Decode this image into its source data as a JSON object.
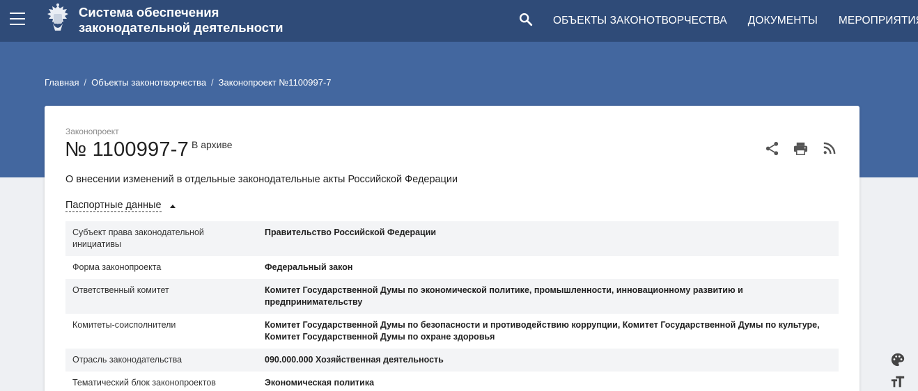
{
  "header": {
    "title_line1": "Система обеспечения",
    "title_line2": "законодательной деятельности",
    "nav": [
      {
        "label": "ОБЪЕКТЫ ЗАКОНОТВОРЧЕСТВА"
      },
      {
        "label": "ДОКУМЕНТЫ"
      },
      {
        "label": "МЕРОПРИЯТИЯ"
      }
    ],
    "icons": {
      "menu": "hamburger-icon",
      "search": "search-icon",
      "logo": "coat-of-arms-emblem"
    }
  },
  "breadcrumb": [
    "Главная",
    "Объекты законотворчества",
    "Законопроект №1100997-7"
  ],
  "bill": {
    "type_label": "Законопроект",
    "number": "№ 1100997-7",
    "status": "В архиве",
    "title": "О внесении изменений в отдельные законодательные акты Российской Федерации",
    "toggle_label": "Паспортные данные",
    "actions": [
      "share-icon",
      "print-icon",
      "rss-icon"
    ]
  },
  "passport": [
    {
      "key": "Субъект права законодательной инициативы",
      "value": "Правительство Российской Федерации"
    },
    {
      "key": "Форма законопроекта",
      "value": "Федеральный закон"
    },
    {
      "key": "Ответственный комитет",
      "value": "Комитет Государственной Думы по экономической политике, промышленности, инновационному развитию и предпринимательству"
    },
    {
      "key": "Комитеты-соисполнители",
      "value": "Комитет Государственной Думы по безопасности и противодействию коррупции, Комитет Государственной Думы по культуре, Комитет Государственной Думы по охране здоровья"
    },
    {
      "key": "Отрасль законодательства",
      "value": "090.000.000 Хозяйственная деятельность"
    },
    {
      "key": "Тематический блок законопроектов",
      "value": "Экономическая политика"
    }
  ],
  "floating_tools": [
    "palette-icon",
    "text-size-icon"
  ],
  "colors": {
    "topbar": "#2f4b78",
    "hero": "#43679f",
    "background": "#eef0f3",
    "row_alt": "#f3f4f6"
  }
}
